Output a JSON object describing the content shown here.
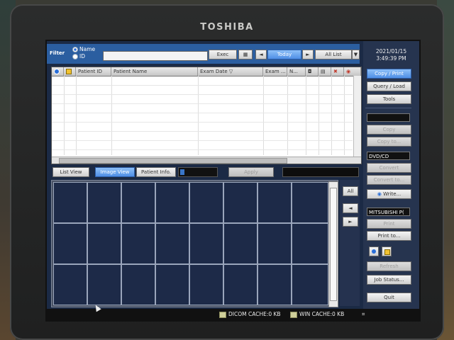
{
  "brand": "TOSHIBA",
  "filter": {
    "label": "Filter",
    "radio_name": "Name",
    "radio_id": "ID",
    "input_value": "",
    "exec_label": "Exec",
    "prev_label": "◄",
    "today_label": "Today",
    "next_label": "►",
    "all_list_label": "All List",
    "dropdown_label": "▼"
  },
  "table": {
    "columns": [
      "",
      "",
      "Patient ID",
      "Patient Name",
      "Exam Date ▽",
      "Exam ...",
      "N...",
      "",
      "",
      "",
      ""
    ],
    "rows": []
  },
  "views": {
    "list_view": "List View",
    "image_view": "Image View",
    "patient_info": "Patient Info.",
    "apply": "Apply"
  },
  "grid_side": {
    "all": "All",
    "left": "◄",
    "right": "►"
  },
  "right_panel": {
    "date": "2021/01/15",
    "time": "3:49:39 PM",
    "copy_print": "Copy / Print",
    "query_load": "Query / Load",
    "tools": "Tools",
    "copy": "Copy",
    "copy_to": "Copy to...",
    "dvd_cd": "DVD/CD",
    "convert": "Convert",
    "convert_to": "Convert to...",
    "write": "Write...",
    "printer": "MITSUBISHI P(",
    "print": "Print",
    "print_to": "Print to...",
    "refresh": "Refresh",
    "job_status": "Job Status...",
    "quit": "Quit"
  },
  "status": {
    "dicom_cache": "DICOM CACHE:0 KB",
    "win_cache": "WIN CACHE:0 KB"
  },
  "colors": {
    "accent": "#2b5ea0",
    "selected_button": "#4f8fe6",
    "screen_bg": "#1b2a45"
  }
}
